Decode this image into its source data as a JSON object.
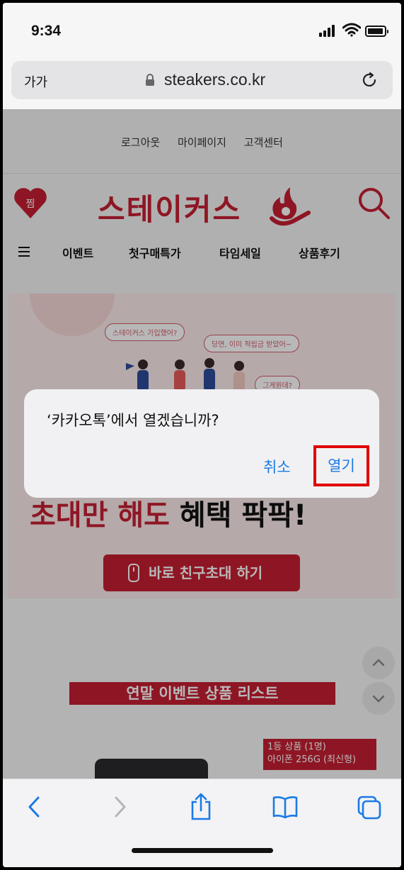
{
  "status_bar": {
    "time": "9:34"
  },
  "url_bar": {
    "text_size_label": "가가",
    "domain": "steakers.co.kr"
  },
  "page": {
    "top_links": [
      "로그아웃",
      "마이페이지",
      "고객센터"
    ],
    "heart_badge": "찜",
    "logo_text": "스테이커스",
    "nav_items": [
      "이벤트",
      "첫구매특가",
      "타임세일",
      "상품후기"
    ],
    "banner": {
      "bubble_1": "스테이커스 가입했어?",
      "bubble_2": "당연, 이미 적립금 받았어~",
      "bubble_3": "그게뭔데?",
      "headline_red": "초대만 해도",
      "headline_black": "혜택 팍팍!",
      "cta_label": "바로 친구초대 하기"
    },
    "section_ribbon": "연말 이벤트 상품 리스트",
    "prize_line_1": "1등 상품 (1명)",
    "prize_line_2": "아이폰 256G (최신형)"
  },
  "alert": {
    "title": "‘카카오톡’에서 열겠습니까?",
    "cancel_label": "취소",
    "open_label": "열기"
  },
  "colors": {
    "brand": "#c51f32",
    "ios_blue": "#1a7ae6",
    "highlight": "#e00000"
  }
}
